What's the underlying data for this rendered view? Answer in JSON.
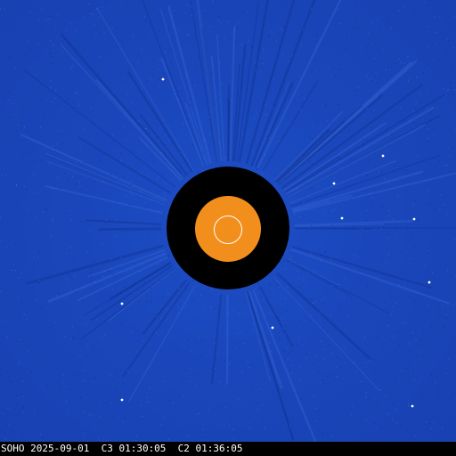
{
  "image": {
    "caption": "SOHO 2025-09-01  C3 01:30:05  C2 01:36:05"
  },
  "colors": {
    "sky": "#1a47bc",
    "occulter": "#000000",
    "c2_field": "#f28f1c",
    "sun_limb": "#ffffff",
    "caption_text": "#ffffff"
  }
}
